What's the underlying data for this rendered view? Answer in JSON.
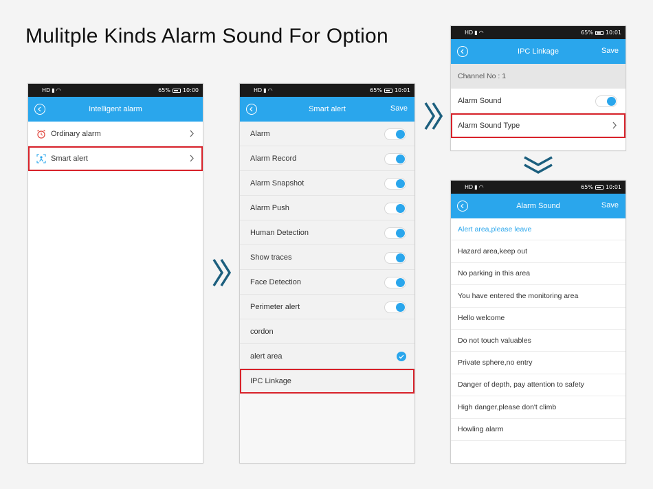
{
  "title": "Mulitple Kinds Alarm Sound For Option",
  "colors": {
    "accent": "#2aa6ec",
    "highlight": "#d8222a",
    "arrow": "#1c5f7e"
  },
  "phone1": {
    "status": {
      "net": "HD",
      "battery": "65%",
      "time": "10:00"
    },
    "nav": {
      "title": "Intelligent alarm"
    },
    "items": [
      {
        "label": "Ordinary alarm",
        "icon": "alarm-clock-icon"
      },
      {
        "label": "Smart alert",
        "icon": "smart-alert-icon"
      }
    ]
  },
  "phone2": {
    "status": {
      "net": "HD",
      "battery": "65%",
      "time": "10:01"
    },
    "nav": {
      "title": "Smart alert",
      "save": "Save"
    },
    "items": [
      {
        "label": "Alarm",
        "control": "toggle",
        "on": true
      },
      {
        "label": "Alarm Record",
        "control": "toggle",
        "on": true
      },
      {
        "label": "Alarm Snapshot",
        "control": "toggle",
        "on": true
      },
      {
        "label": "Alarm Push",
        "control": "toggle",
        "on": true
      },
      {
        "label": "Human Detection",
        "control": "toggle",
        "on": true
      },
      {
        "label": "Show traces",
        "control": "toggle",
        "on": true
      },
      {
        "label": "Face Detection",
        "control": "toggle",
        "on": true
      },
      {
        "label": "Perimeter alert",
        "control": "toggle",
        "on": true
      },
      {
        "label": "cordon",
        "control": "none"
      },
      {
        "label": "alert area",
        "control": "check",
        "checked": true
      },
      {
        "label": "IPC Linkage",
        "control": "none"
      }
    ]
  },
  "phone3": {
    "status": {
      "net": "HD",
      "battery": "65%",
      "time": "10:01"
    },
    "nav": {
      "title": "IPC Linkage",
      "save": "Save"
    },
    "channel": "Channel No : 1",
    "alarm_sound": {
      "label": "Alarm Sound",
      "on": true
    },
    "alarm_sound_type": {
      "label": "Alarm Sound Type"
    }
  },
  "phone4": {
    "status": {
      "net": "HD",
      "battery": "65%",
      "time": "10:01"
    },
    "nav": {
      "title": "Alarm Sound",
      "save": "Save"
    },
    "sounds": [
      "Alert area,please leave",
      "Hazard area,keep out",
      "No parking in this area",
      "You have entered the monitoring area",
      "Hello welcome",
      "Do not touch valuables",
      "Private sphere,no entry",
      "Danger of depth, pay attention to safety",
      "High danger,please don't climb",
      "Howling alarm"
    ],
    "selected_index": 0
  }
}
